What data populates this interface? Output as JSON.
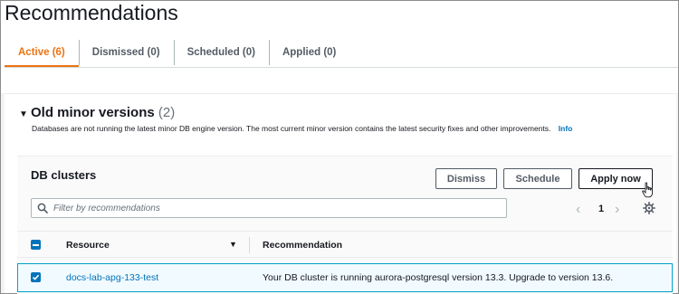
{
  "page": {
    "title": "Recommendations"
  },
  "tabs": [
    {
      "label": "Active (6)",
      "active": true
    },
    {
      "label": "Dismissed (0)"
    },
    {
      "label": "Scheduled (0)"
    },
    {
      "label": "Applied (0)"
    }
  ],
  "section": {
    "title": "Old minor versions",
    "count": "(2)",
    "description": "Databases are not running the latest minor DB engine version. The most current minor version contains the latest security fixes and other improvements.",
    "info_link": "Info"
  },
  "panel": {
    "title": "DB clusters",
    "buttons": {
      "dismiss": "Dismiss",
      "schedule": "Schedule",
      "apply_now": "Apply now"
    },
    "search": {
      "placeholder": "Filter by recommendations",
      "value": ""
    },
    "pagination": {
      "current_page": "1"
    }
  },
  "table": {
    "columns": {
      "resource": "Resource",
      "recommendation": "Recommendation"
    },
    "rows": [
      {
        "resource": "docs-lab-apg-133-test",
        "recommendation": "Your DB cluster is running aurora-postgresql version 13.3. Upgrade to version 13.6.",
        "selected": true
      }
    ]
  },
  "colors": {
    "accent": "#ec7211",
    "link": "#0073bb",
    "selection_border": "#00a1c9"
  }
}
